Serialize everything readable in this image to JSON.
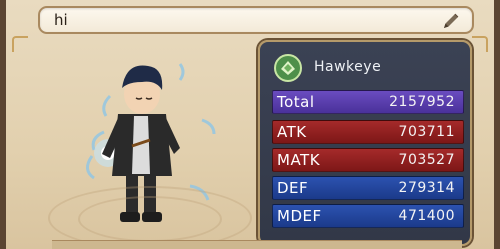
{
  "profile": {
    "name": "hi"
  },
  "character": {
    "class_name": "Hawkeye"
  },
  "stats": [
    {
      "label": "Total",
      "value": "2157952",
      "color": "#5b3fa8"
    },
    {
      "label": "ATK",
      "value": "703711",
      "color": "#8e1d1d"
    },
    {
      "label": "MATK",
      "value": "703527",
      "color": "#8e1d1d"
    },
    {
      "label": "DEF",
      "value": "279314",
      "color": "#1f3f97"
    },
    {
      "label": "MDEF",
      "value": "471400",
      "color": "#1f3f97"
    }
  ],
  "icons": {
    "edit": "pencil-icon",
    "class": "hawkeye-class-icon"
  }
}
